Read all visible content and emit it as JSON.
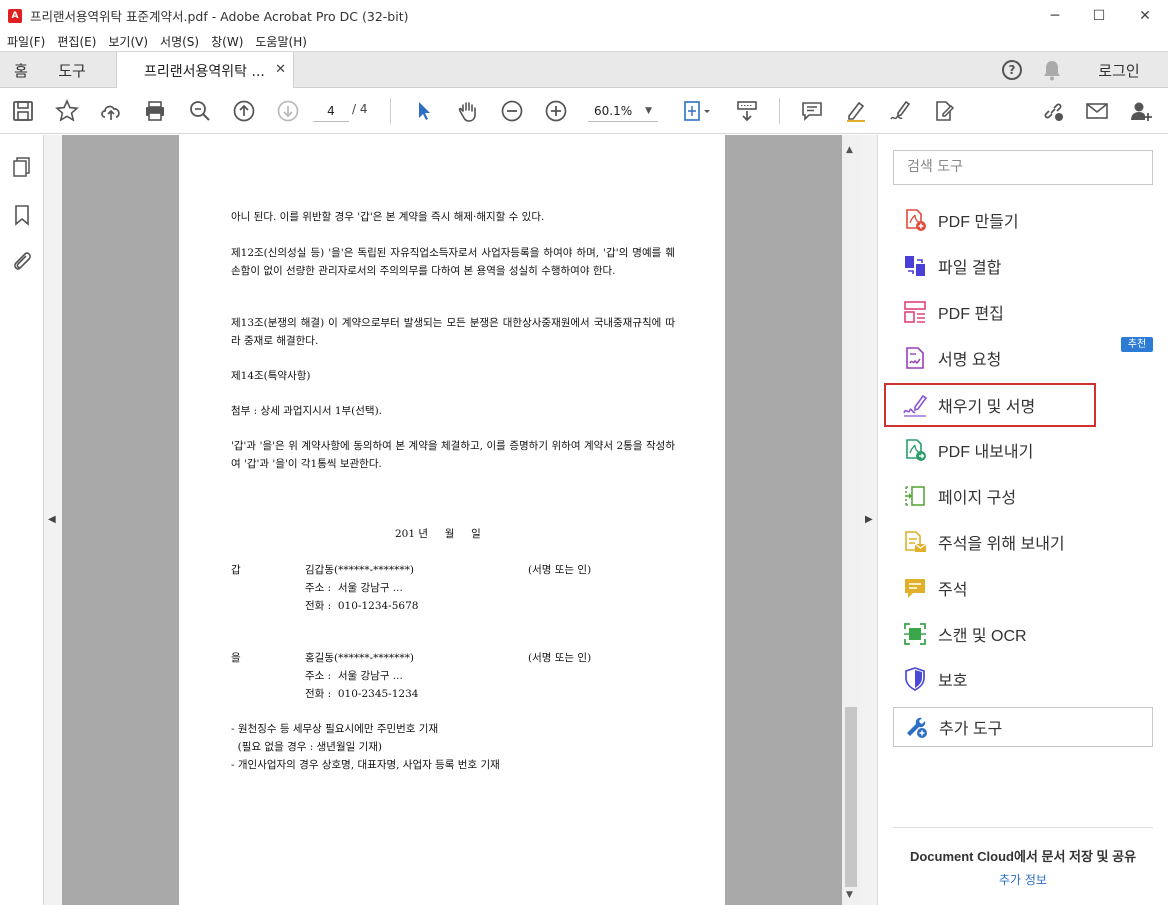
{
  "window": {
    "title": "프리랜서용역위탁 표준계약서.pdf - Adobe Acrobat Pro DC (32-bit)",
    "app_icon": "acrobat-icon",
    "controls": [
      "─",
      "☐",
      "✕"
    ]
  },
  "menu": [
    "파일(F)",
    "편집(E)",
    "보기(V)",
    "서명(S)",
    "창(W)",
    "도움말(H)"
  ],
  "tabs": {
    "home": "홈",
    "tools": "도구",
    "doc": "프리랜서용역위탁 ...",
    "close": "✕",
    "login": "로그인",
    "help": "?"
  },
  "toolbar": {
    "page_current": "4",
    "page_total": "/ 4",
    "zoom": "60.1%",
    "zoom_caret": "▼"
  },
  "document": {
    "lines": [
      "아니 된다. 이를 위반할 경우 '갑'은 본 계약을 즉시 해제·해지할 수 있다.",
      "제12조(신의성실 등) '을'은 독립된 자유직업소득자로서 사업자등록을 하여야 하며, '갑'의 명예를 훼손함이 없이 선량한 관리자로서의 주의의무를 다하여 본 용역을 성실히 수행하여야 한다.",
      "제13조(분쟁의 해결) 이 계약으로부터 발생되는 모든 분쟁은 대한상사중재원에서 국내중재규칙에 따라 중재로 해결한다.",
      "제14조(특약사항)",
      "첨부 : 상세 과업지시서 1부(선택).",
      "'갑'과 '을'은 위 계약사항에 동의하여 본 계약을 체결하고, 이를 증명하기 위하여 계약서 2통을 작성하여 '갑'과 '을'이 각1통씩 보관한다."
    ],
    "date_line": "201 년     월     일",
    "party_a": {
      "label": "갑",
      "name": "김갑동(******-*******)",
      "sign": "(서명 또는 인)",
      "address": "주소 :  서울 강남구 ...",
      "phone": "전화 :  010-1234-5678"
    },
    "party_b": {
      "label": "을",
      "name": "홍길동(******-*******)",
      "sign": "(서명 또는 인)",
      "address": "주소 :  서울 강남구 ...",
      "phone": "전화 :  010-2345-1234"
    },
    "notes": [
      "- 원천징수 등 세무상 필요시에만 주민번호 기재",
      "  (필요 없을 경우 : 생년월일 기재)",
      "- 개인사업자의 경우 상호명, 대표자명, 사업자 등록 번호 기재"
    ]
  },
  "right_panel": {
    "search_placeholder": "검색 도구",
    "tools": [
      {
        "label": "PDF 만들기",
        "icon": "create-pdf-icon",
        "color": "#e04b3c"
      },
      {
        "label": "파일 결합",
        "icon": "combine-files-icon",
        "color": "#4a3fd6"
      },
      {
        "label": "PDF 편집",
        "icon": "edit-pdf-icon",
        "color": "#e0407a"
      },
      {
        "label": "서명 요청",
        "icon": "request-signature-icon",
        "color": "#9b3fb8"
      },
      {
        "label": "채우기 및 서명",
        "icon": "fill-sign-icon",
        "color": "#8a55d4"
      },
      {
        "label": "PDF 내보내기",
        "icon": "export-pdf-icon",
        "color": "#2a9d6b"
      },
      {
        "label": "페이지 구성",
        "icon": "organize-pages-icon",
        "color": "#5aa83a"
      },
      {
        "label": "주석을 위해 보내기",
        "icon": "send-comments-icon",
        "color": "#e0b02a"
      },
      {
        "label": "주석",
        "icon": "comment-icon",
        "color": "#e0b02a"
      },
      {
        "label": "스캔 및 OCR",
        "icon": "scan-ocr-icon",
        "color": "#3aa64a"
      },
      {
        "label": "보호",
        "icon": "protect-icon",
        "color": "#4a4ad6"
      },
      {
        "label": "추가 도구",
        "icon": "more-tools-icon",
        "color": "#2c6fc4"
      }
    ],
    "badge": "추천",
    "cloud_text": "Document Cloud에서 문서 저장 및 공유",
    "cloud_link": "추가 정보"
  }
}
